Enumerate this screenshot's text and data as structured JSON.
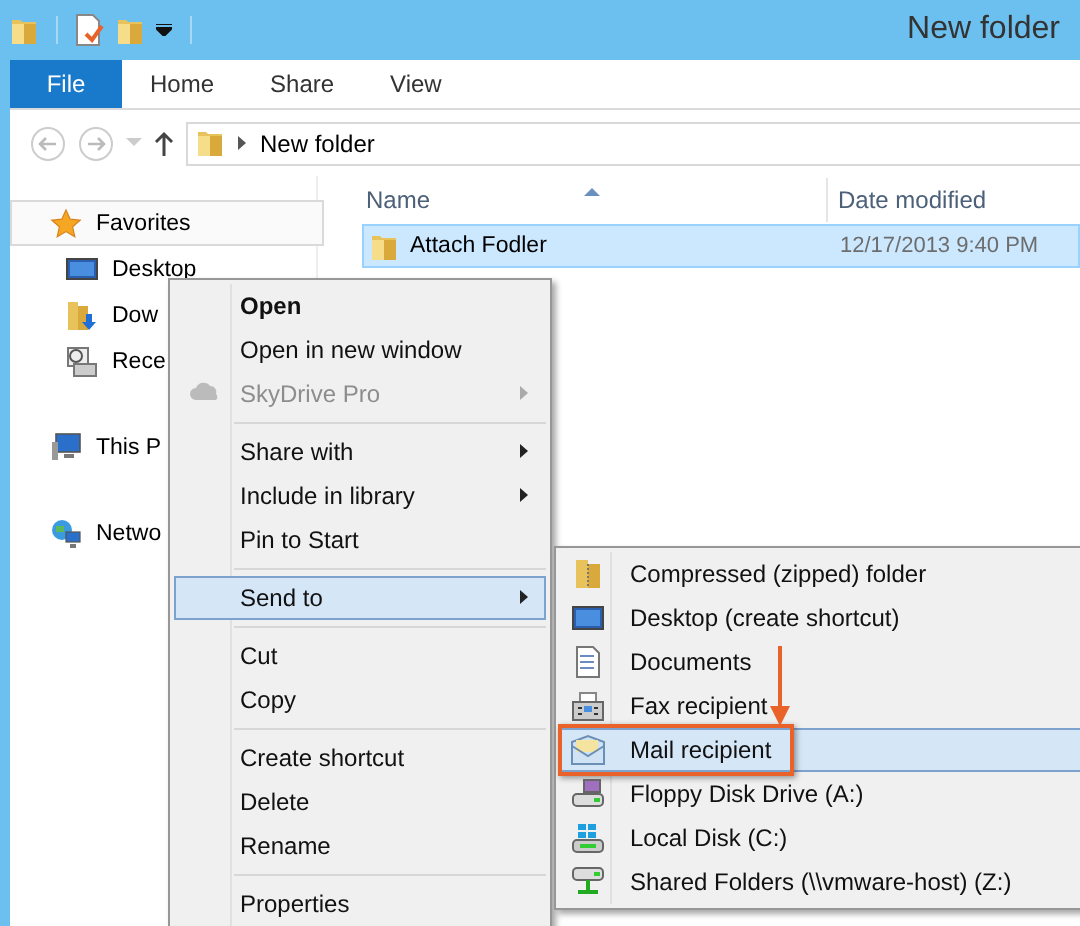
{
  "window": {
    "title": "New folder"
  },
  "ribbon_tabs": [
    {
      "label": "File",
      "kind": "file"
    },
    {
      "label": "Home",
      "kind": "tab"
    },
    {
      "label": "Share",
      "kind": "tab"
    },
    {
      "label": "View",
      "kind": "tab"
    }
  ],
  "address_bar": {
    "path": "New folder"
  },
  "navigation_pane": {
    "items": [
      {
        "label": "Favorites",
        "selected": true,
        "children": [
          {
            "label": "Desktop",
            "selected": false
          },
          {
            "label": "Dow",
            "selected": false
          },
          {
            "label": "Rece",
            "selected": false
          }
        ]
      },
      {
        "label": "This P",
        "selected": false
      },
      {
        "label": "Netwo",
        "selected": false
      }
    ]
  },
  "file_list": {
    "columns": [
      {
        "label": "Name",
        "sorted": true
      },
      {
        "label": "Date modified",
        "sorted": false
      }
    ],
    "rows": [
      {
        "name": "Attach Fodler",
        "date_modified": "12/17/2013 9:40 PM",
        "selected": true
      }
    ]
  },
  "context_menu": {
    "groups": [
      [
        {
          "label": "Open",
          "default": true,
          "disabled": false,
          "submenu": false,
          "selected": false
        },
        {
          "label": "Open in new window",
          "default": false,
          "disabled": false,
          "submenu": false,
          "selected": false
        },
        {
          "label": "SkyDrive Pro",
          "default": false,
          "disabled": true,
          "submenu": true,
          "selected": false
        }
      ],
      [
        {
          "label": "Share with",
          "default": false,
          "disabled": false,
          "submenu": true,
          "selected": false
        },
        {
          "label": "Include in library",
          "default": false,
          "disabled": false,
          "submenu": true,
          "selected": false
        },
        {
          "label": "Pin to Start",
          "default": false,
          "disabled": false,
          "submenu": false,
          "selected": false
        }
      ],
      [
        {
          "label": "Send to",
          "default": false,
          "disabled": false,
          "submenu": true,
          "selected": true
        }
      ],
      [
        {
          "label": "Cut",
          "default": false,
          "disabled": false,
          "submenu": false,
          "selected": false
        },
        {
          "label": "Copy",
          "default": false,
          "disabled": false,
          "submenu": false,
          "selected": false
        }
      ],
      [
        {
          "label": "Create shortcut",
          "default": false,
          "disabled": false,
          "submenu": false,
          "selected": false
        },
        {
          "label": "Delete",
          "default": false,
          "disabled": false,
          "submenu": false,
          "selected": false
        },
        {
          "label": "Rename",
          "default": false,
          "disabled": false,
          "submenu": false,
          "selected": false
        }
      ],
      [
        {
          "label": "Properties",
          "default": false,
          "disabled": false,
          "submenu": false,
          "selected": false
        }
      ]
    ]
  },
  "send_to_menu": {
    "items": [
      {
        "label": "Compressed (zipped) folder",
        "selected": false,
        "annotated": false
      },
      {
        "label": "Desktop (create shortcut)",
        "selected": false,
        "annotated": false
      },
      {
        "label": "Documents",
        "selected": false,
        "annotated": false
      },
      {
        "label": "Fax recipient",
        "selected": false,
        "annotated": false
      },
      {
        "label": "Mail recipient",
        "selected": true,
        "annotated": true
      },
      {
        "label": "Floppy Disk Drive (A:)",
        "selected": false,
        "annotated": false
      },
      {
        "label": "Local Disk (C:)",
        "selected": false,
        "annotated": false
      },
      {
        "label": "Shared Folders (\\\\vmware-host) (Z:)",
        "selected": false,
        "annotated": false
      }
    ]
  }
}
